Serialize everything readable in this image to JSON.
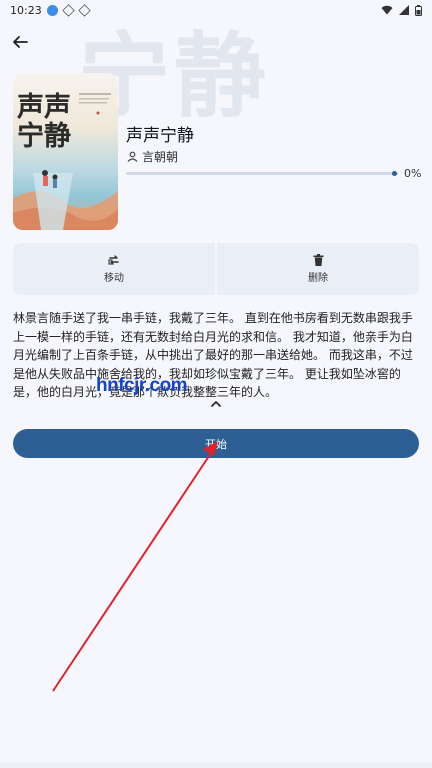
{
  "status_bar": {
    "time": "10:23"
  },
  "background_title": "宁静",
  "book": {
    "title": "声声宁静",
    "author": "言朝朝",
    "cover_title": "声声\n宁静",
    "progress_fraction": 0.0,
    "progress_label": "0%"
  },
  "actions": {
    "move_label": "移动",
    "delete_label": "删除"
  },
  "description": "林景言随手送了我一串手链，我戴了三年。 直到在他书房看到无数串跟我手上一模一样的手链，还有无数封给白月光的求和信。 我才知道，他亲手为白月光编制了上百条手链，从中挑出了最好的那一串送给她。 而我这串，不过是他从失败品中施舍给我的，我却如珍似宝戴了三年。 更让我如坠冰窖的是，他的白月光，竟是那个欺负我整整三年的人。",
  "watermark": "hnfcjr.com",
  "start_button_label": "开始",
  "colors": {
    "accent": "#2e5f94",
    "panel": "#e9eef7",
    "background": "#f5f7fc",
    "annotation": "#e0232b",
    "watermark": "#1544c8"
  },
  "icons": {
    "back": "arrow-left-icon",
    "author": "person-icon",
    "move": "move-icon",
    "delete": "trash-icon",
    "collapse": "chevron-up-icon"
  }
}
